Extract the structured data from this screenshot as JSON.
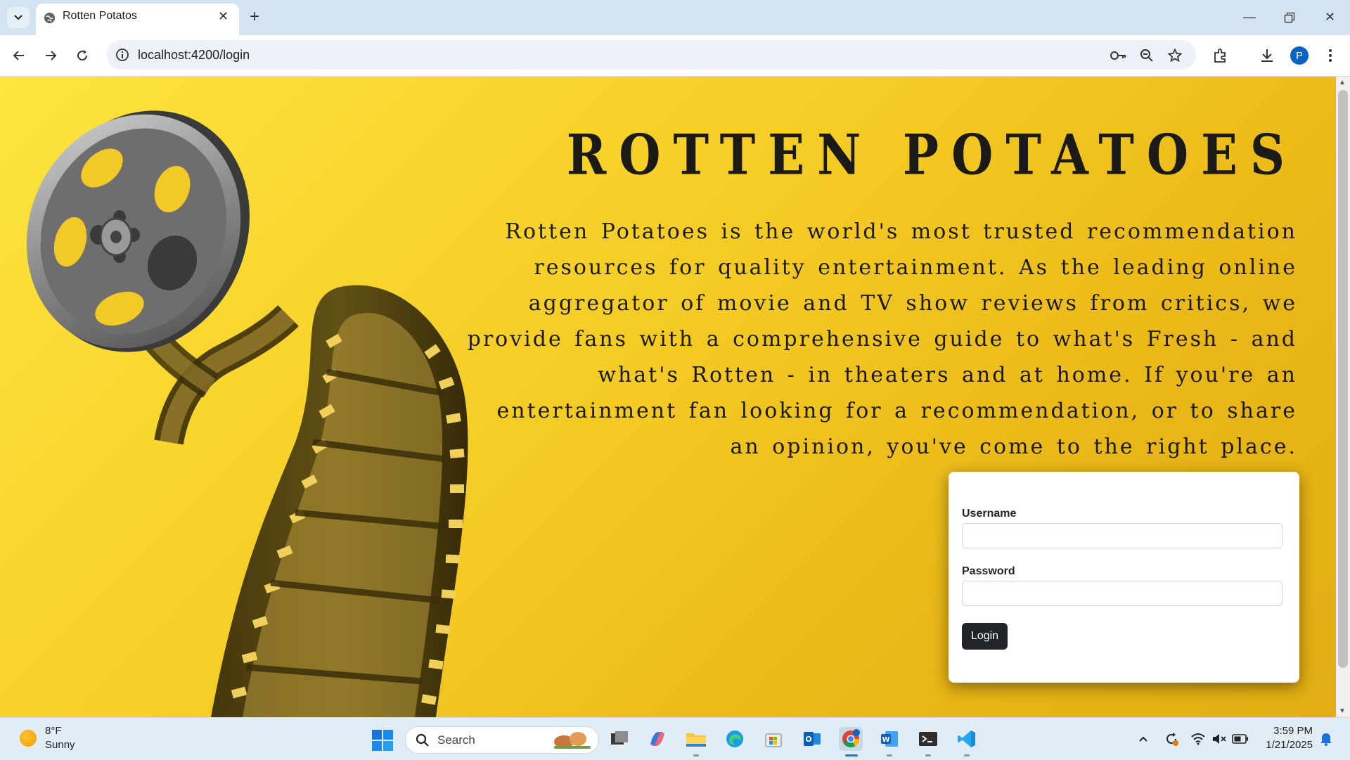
{
  "browser": {
    "tab_title": "Rotten Potatos",
    "url": "localhost:4200/login",
    "profile_initial": "P"
  },
  "site": {
    "title": "ROTTEN POTATOES",
    "intro": "Rotten Potatoes is the world's most trusted recommendation resources for quality entertainment. As the leading online aggregator of movie and TV show reviews from critics, we provide fans with a comprehensive guide to what's Fresh - and what's Rotten - in theaters and at home. If you're an entertainment fan looking for a recommendation, or to share an opinion, you've come to the right place."
  },
  "login": {
    "username_label": "Username",
    "username_value": "",
    "password_label": "Password",
    "password_value": "",
    "button_label": "Login"
  },
  "taskbar": {
    "weather_temp": "8°F",
    "weather_condition": "Sunny",
    "search_placeholder": "Search",
    "time": "3:59 PM",
    "date": "1/21/2025"
  },
  "colors": {
    "page_gradient_start": "#fde43f",
    "page_gradient_end": "#e3ae14",
    "text_dark": "#1c1a16",
    "login_button": "#212529",
    "profile_avatar": "#0b63c4"
  }
}
